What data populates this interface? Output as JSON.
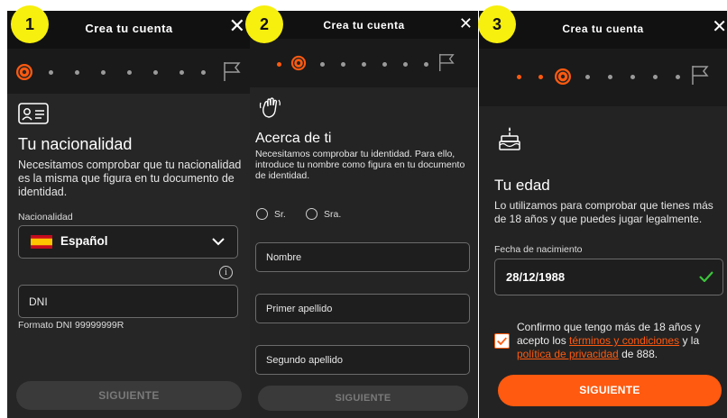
{
  "panel1": {
    "step": "1",
    "title": "Crea tu cuenta",
    "close": "✕",
    "heading": "Tu nacionalidad",
    "description": "Necesitamos comprobar que tu nacionalidad es la misma que figura en tu documento de identidad.",
    "nationality_label": "Nacionalidad",
    "nationality_value": "Español",
    "info_icon_text": "i",
    "dni_placeholder": "DNI",
    "dni_format": "Formato DNI 99999999R",
    "next_button": "SIGUIENTE"
  },
  "panel2": {
    "step": "2",
    "title": "Crea tu cuenta",
    "close": "✕",
    "heading": "Acerca de ti",
    "description": "Necesitamos comprobar tu identidad. Para ello, introduce tu nombre como figura en tu documento de identidad.",
    "title_options": [
      "Sr.",
      "Sra."
    ],
    "first_name_placeholder": "Nombre",
    "surname1_placeholder": "Primer apellido",
    "surname2_placeholder": "Segundo apellido",
    "next_button": "SIGUIENTE"
  },
  "panel3": {
    "step": "3",
    "title": "Crea tu cuenta",
    "close": "✕",
    "heading": "Tu edad",
    "description": "Lo utilizamos para comprobar que tienes más de 18 años y que puedes jugar legalmente.",
    "dob_label": "Fecha de nacimiento",
    "dob_value": "28/12/1988",
    "confirm_text_1": "Confirmo que tengo más de 18 años y acepto los ",
    "terms_link": "términos y condiciones",
    "confirm_text_2": " y la ",
    "privacy_link": "política de privacidad",
    "confirm_text_3": " de 888.",
    "checkbox_checked": true,
    "next_button": "SIGUIENTE"
  },
  "colors": {
    "accent": "#ff5a0f",
    "badge": "#f7ef0e",
    "panel_bg": "#262626",
    "valid_check": "#3cc43c"
  },
  "icons": [
    "soccer-ball-icon",
    "finish-flag-icon",
    "id-card-icon",
    "waving-hand-icon",
    "birthday-cake-icon",
    "spain-flag-icon",
    "chevron-down-icon",
    "info-icon",
    "check-icon"
  ]
}
